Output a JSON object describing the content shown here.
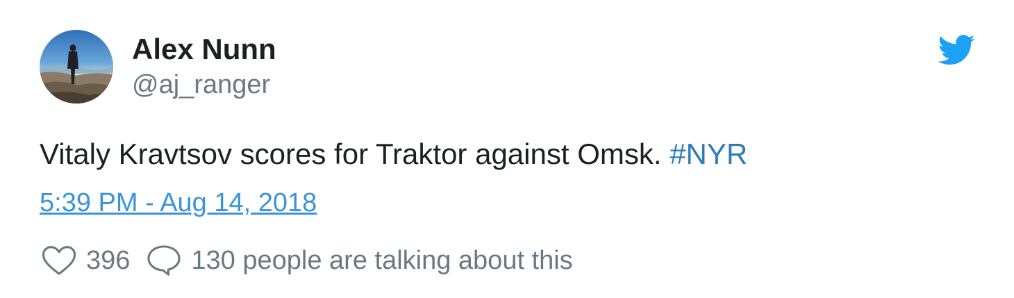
{
  "author": {
    "name": "Alex Nunn",
    "handle": "@aj_ranger",
    "avatar_icon": "avatar-photo"
  },
  "brand": {
    "icon": "twitter-bird-icon",
    "color": "#1da1f2"
  },
  "tweet": {
    "text": "Vitaly Kravtsov scores for Traktor against Omsk. ",
    "hashtag": "#NYR",
    "timestamp": "5:39 PM - Aug 14, 2018"
  },
  "actions": {
    "like_icon": "heart-icon",
    "like_count": "396",
    "reply_icon": "speech-bubble-icon",
    "talking_text": "130 people are talking about this"
  },
  "colors": {
    "text": "#1c2022",
    "muted": "#697882",
    "link": "#3b94d9",
    "hashtag": "#2b7bb9"
  }
}
